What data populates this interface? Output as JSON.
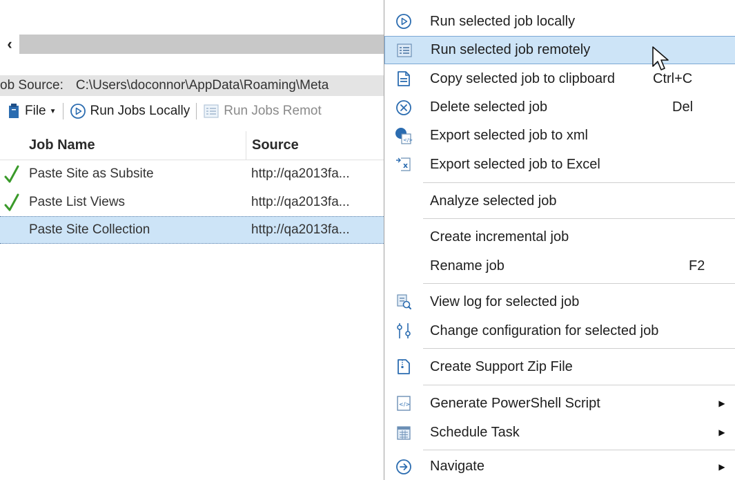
{
  "job_panel": {
    "job_source_label": "ob Source:",
    "job_source_path": "C:\\Users\\doconnor\\AppData\\Roaming\\Meta",
    "toolbar": {
      "file_label": "File",
      "run_locally_label": "Run Jobs Locally",
      "run_remotely_label": "Run Jobs Remot"
    },
    "columns": [
      "Job Name",
      "Source"
    ],
    "rows": [
      {
        "name": "Paste Site as Subsite",
        "source": "http://qa2013fa...",
        "status": "success"
      },
      {
        "name": "Paste List Views",
        "source": "http://qa2013fa...",
        "status": "success"
      },
      {
        "name": "Paste Site Collection",
        "source": "http://qa2013fa...",
        "status": "none",
        "selected": true
      }
    ]
  },
  "context_menu": {
    "items": [
      {
        "label": "Run selected job locally",
        "icon": "play-circle-icon"
      },
      {
        "label": "Run selected job remotely",
        "icon": "remote-run-icon",
        "highlighted": true
      },
      {
        "label": "Copy selected job to clipboard",
        "shortcut": "Ctrl+C",
        "icon": "clipboard-icon"
      },
      {
        "label": "Delete selected job",
        "shortcut": "Del",
        "icon": "delete-circle-icon"
      },
      {
        "label": "Export selected job to xml",
        "icon": "export-xml-icon"
      },
      {
        "label": "Export selected job to Excel",
        "icon": "export-excel-icon"
      },
      {
        "label": "Analyze selected job"
      },
      {
        "label": "Create incremental job"
      },
      {
        "label": "Rename job",
        "shortcut": "F2"
      },
      {
        "label": "View log for selected job",
        "icon": "view-log-icon"
      },
      {
        "label": "Change configuration for selected job",
        "icon": "config-icon"
      },
      {
        "label": "Create Support Zip File",
        "icon": "zip-file-icon"
      },
      {
        "label": "Generate PowerShell Script",
        "icon": "powershell-script-icon",
        "submenu": true
      },
      {
        "label": "Schedule Task",
        "icon": "calendar-icon",
        "submenu": true
      },
      {
        "label": "Navigate",
        "icon": "navigate-icon",
        "submenu": true
      }
    ]
  },
  "colors": {
    "highlight": "#cde4f7",
    "highlight_border": "#7ba7d4",
    "icon_blue": "#2b6cb0",
    "success_green": "#3a9a2a"
  }
}
